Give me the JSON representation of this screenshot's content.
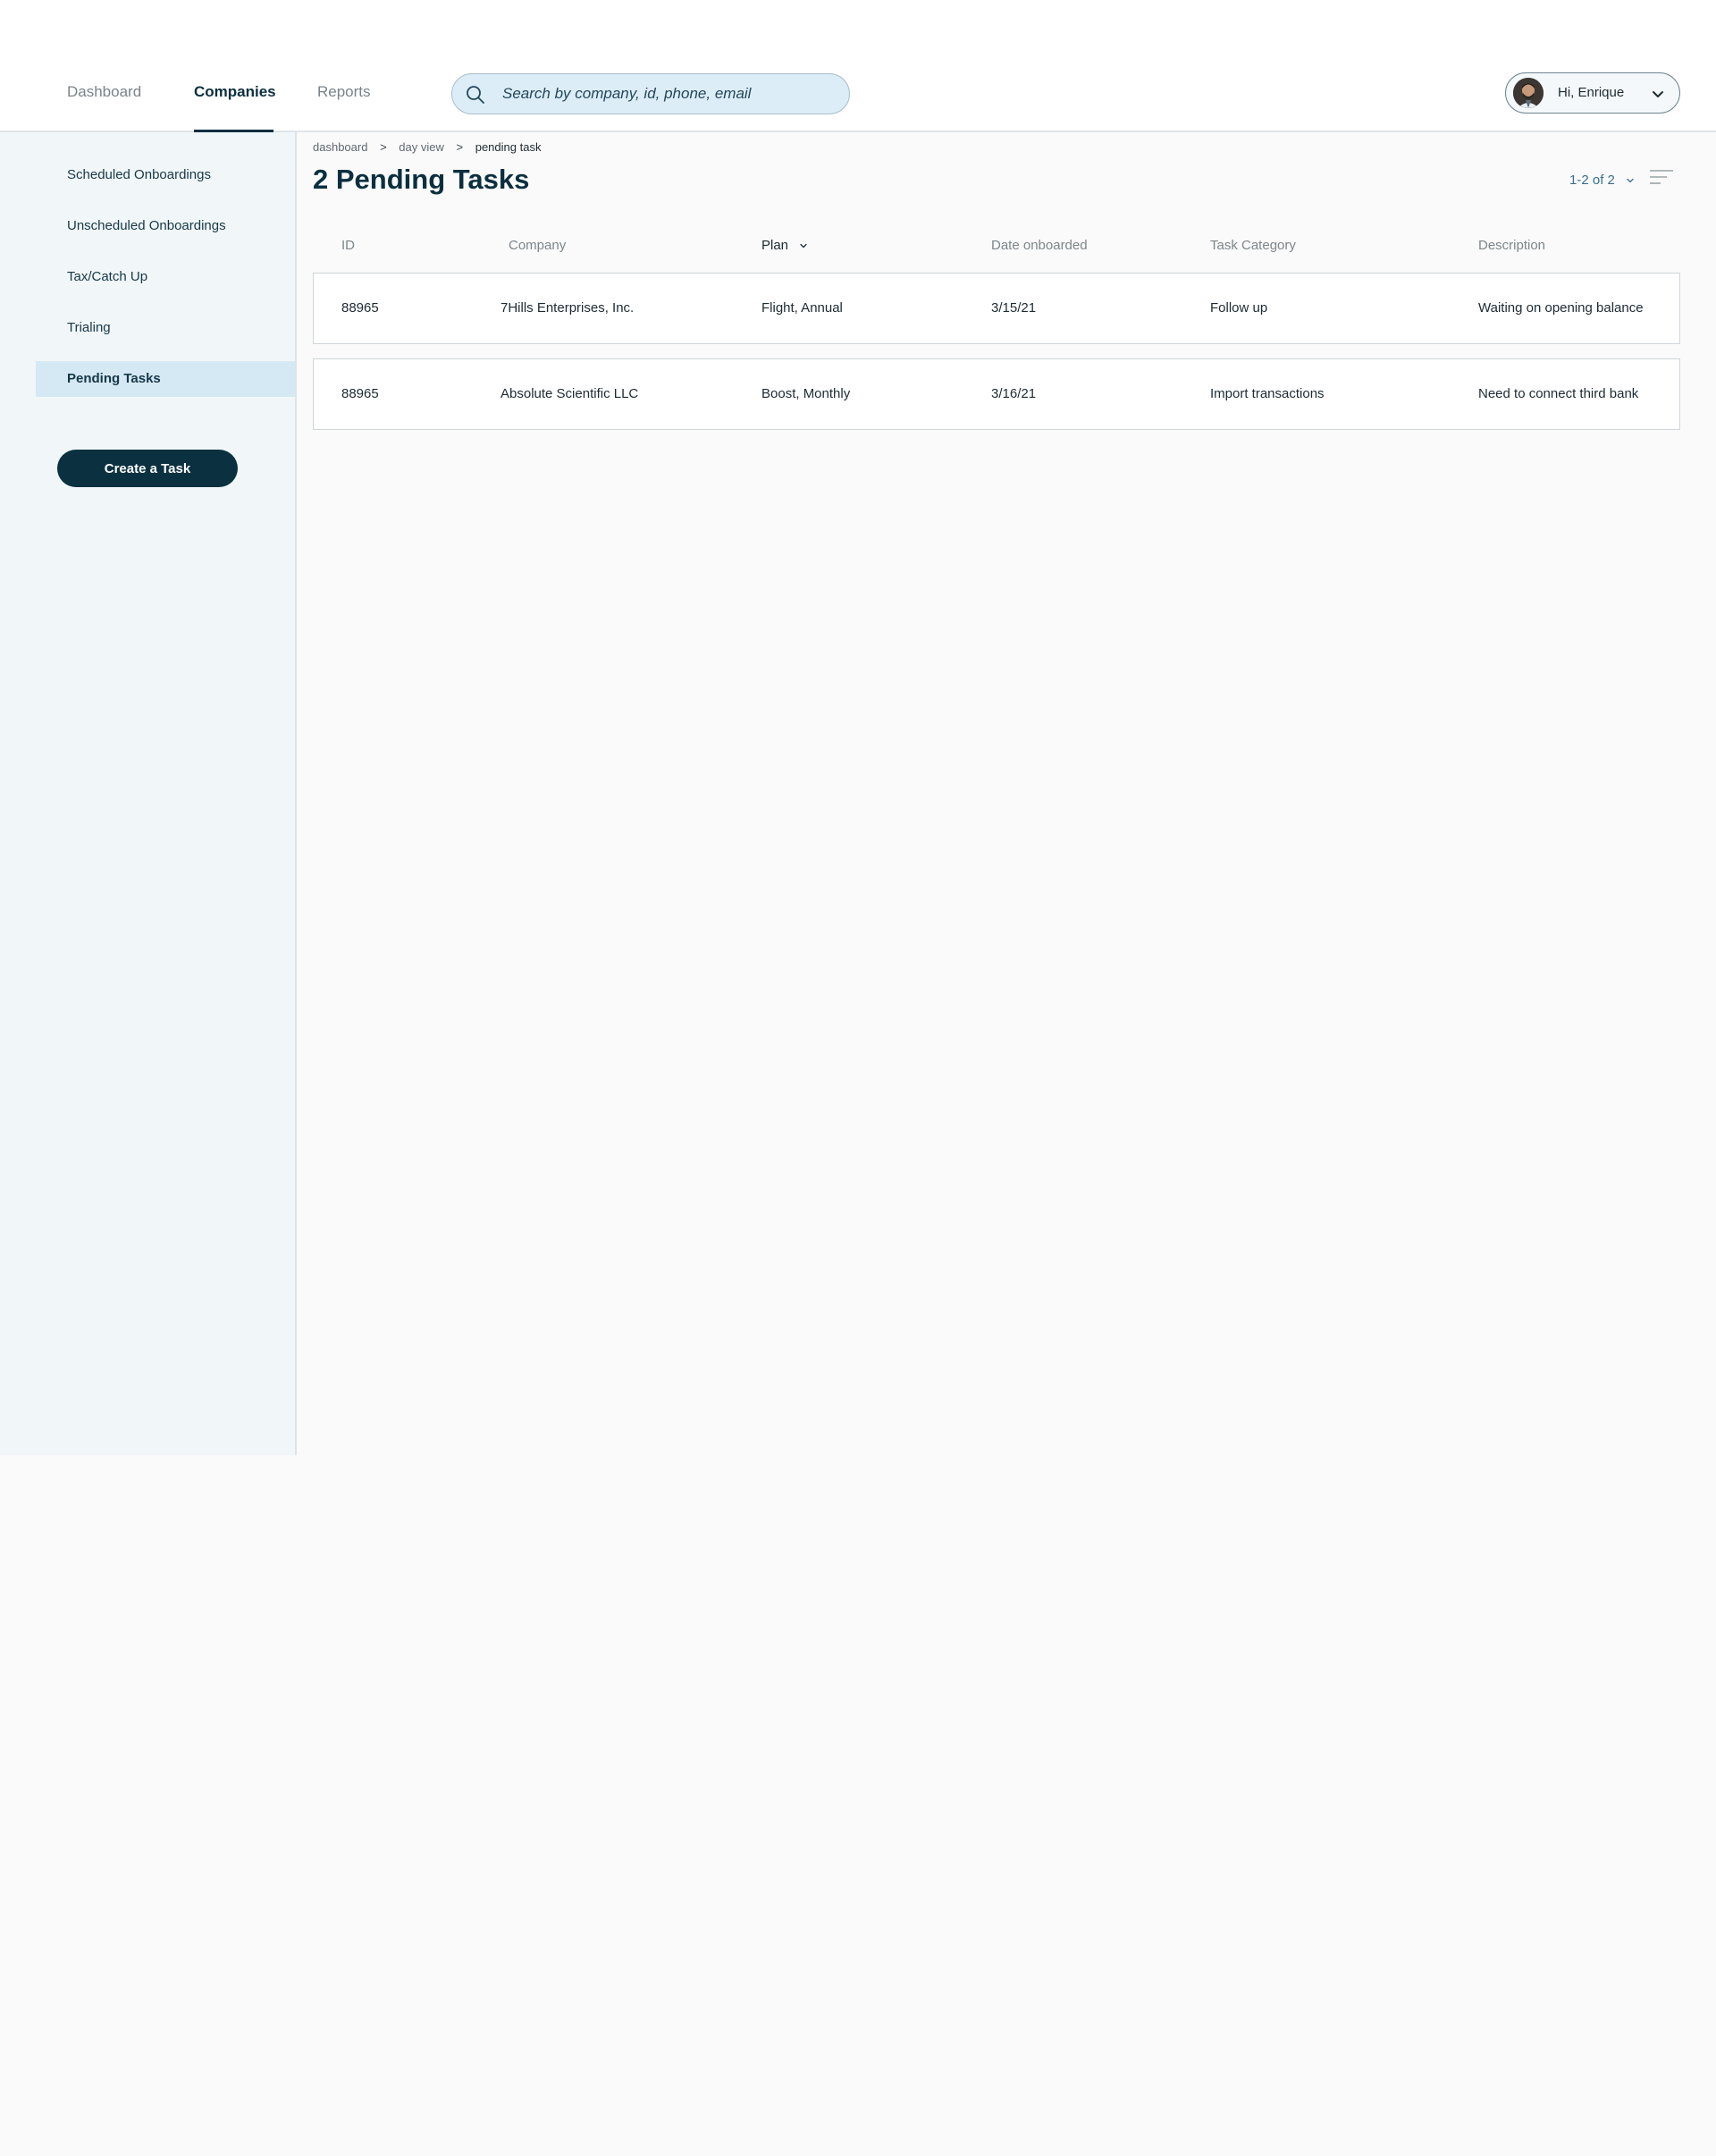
{
  "nav": {
    "tabs": [
      {
        "label": "Dashboard"
      },
      {
        "label": "Companies"
      },
      {
        "label": "Reports"
      }
    ],
    "active_tab": "Companies"
  },
  "search": {
    "placeholder": "Search by company, id, phone, email",
    "value": ""
  },
  "user": {
    "greeting": "Hi, Enrique"
  },
  "sidebar": {
    "items": [
      {
        "label": "Scheduled Onboardings"
      },
      {
        "label": "Unscheduled Onboardings"
      },
      {
        "label": "Tax/Catch Up"
      },
      {
        "label": "Trialing"
      },
      {
        "label": "Pending Tasks"
      }
    ],
    "active_item": "Pending Tasks",
    "create_button": "Create a Task"
  },
  "breadcrumb": {
    "items": [
      "dashboard",
      "day view",
      "pending task"
    ],
    "separator": ">"
  },
  "main": {
    "title": "2 Pending Tasks",
    "pager": "1-2 of 2"
  },
  "table": {
    "columns": [
      "ID",
      "Company",
      "Plan",
      "Date onboarded",
      "Task Category",
      "Description"
    ],
    "rows": [
      [
        "88965",
        "7Hills Enterprises, Inc.",
        "Flight, Annual",
        "3/15/21",
        "Follow up",
        "Waiting on opening balance"
      ],
      [
        "88965",
        "Absolute Scientific LLC",
        "Boost, Monthly",
        "3/16/21",
        "Import transactions",
        "Need to connect third bank"
      ]
    ]
  },
  "icons": {
    "search": "search-icon",
    "user_menu": "chevron-down-icon",
    "pager": "chevron-down-icon",
    "sort": "chevron-down-icon",
    "filter": "filter-lines-icon"
  },
  "colors": {
    "primary": "#0b2f3f",
    "sidebar_bg": "#f1f6f8",
    "sidebar_active": "#d5e9f4",
    "search_bg": "#dcedf7",
    "accent_link": "#3b6f8c"
  }
}
